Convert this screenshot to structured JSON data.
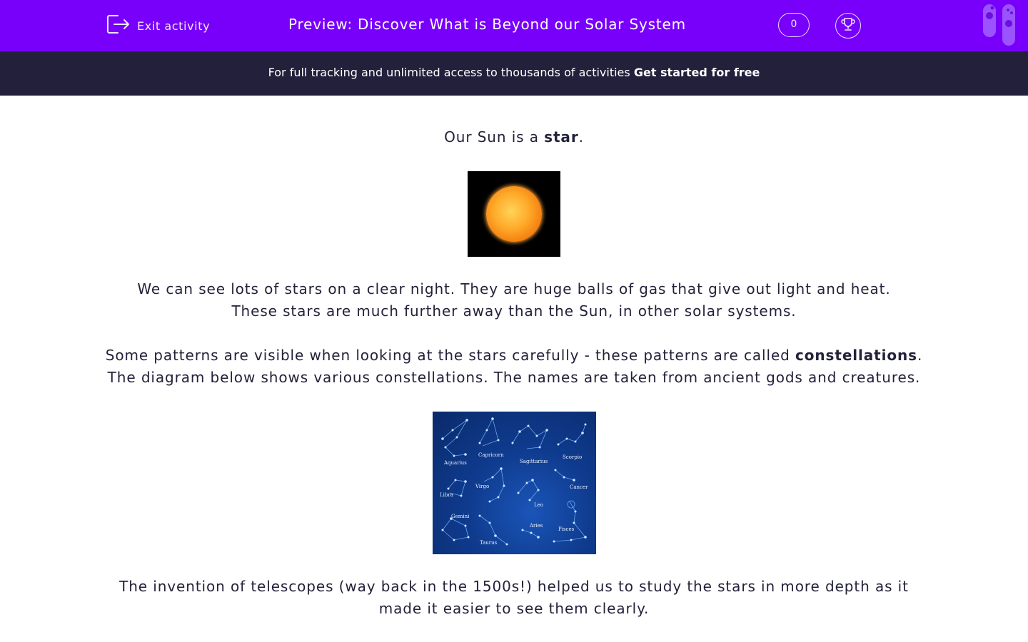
{
  "header": {
    "exit_label": "Exit activity",
    "title": "Preview: Discover What is Beyond our Solar System",
    "score": "0",
    "brand_color": "#7800fa"
  },
  "banner": {
    "text": "For full tracking and unlimited access to thousands of activities ",
    "cta": "Get started for free"
  },
  "content": {
    "p1_pre": "Our Sun is a ",
    "p1_bold": "star",
    "p1_post": ".",
    "p2_line1": "We can see lots of stars on a clear night. They are huge balls of gas that give out light and heat.",
    "p2_line2": "These stars are much further away than the Sun, in other solar systems.",
    "p3_pre": "Some patterns are visible when looking at the stars carefully - these patterns are called ",
    "p3_bold": "constellations",
    "p3_post": ".",
    "p3_line2": "The diagram below shows various constellations. The names are taken from ancient gods and creatures.",
    "p4_line1": "The invention of telescopes (way back in the 1500s!) helped us to study the stars in more depth as it",
    "p4_line2": "made it easier to see them clearly."
  },
  "constellation_labels": {
    "aquarius": "Aquarius",
    "capricorn": "Capricorn",
    "sagittarius": "Sagittarius",
    "scorpio": "Scorpio",
    "libra": "Libra",
    "virgo": "Virgo",
    "cancer": "Cancer",
    "leo": "Leo",
    "gemini": "Gemini",
    "aries": "Aries",
    "pisces": "Pisces",
    "taurus": "Taurus"
  }
}
